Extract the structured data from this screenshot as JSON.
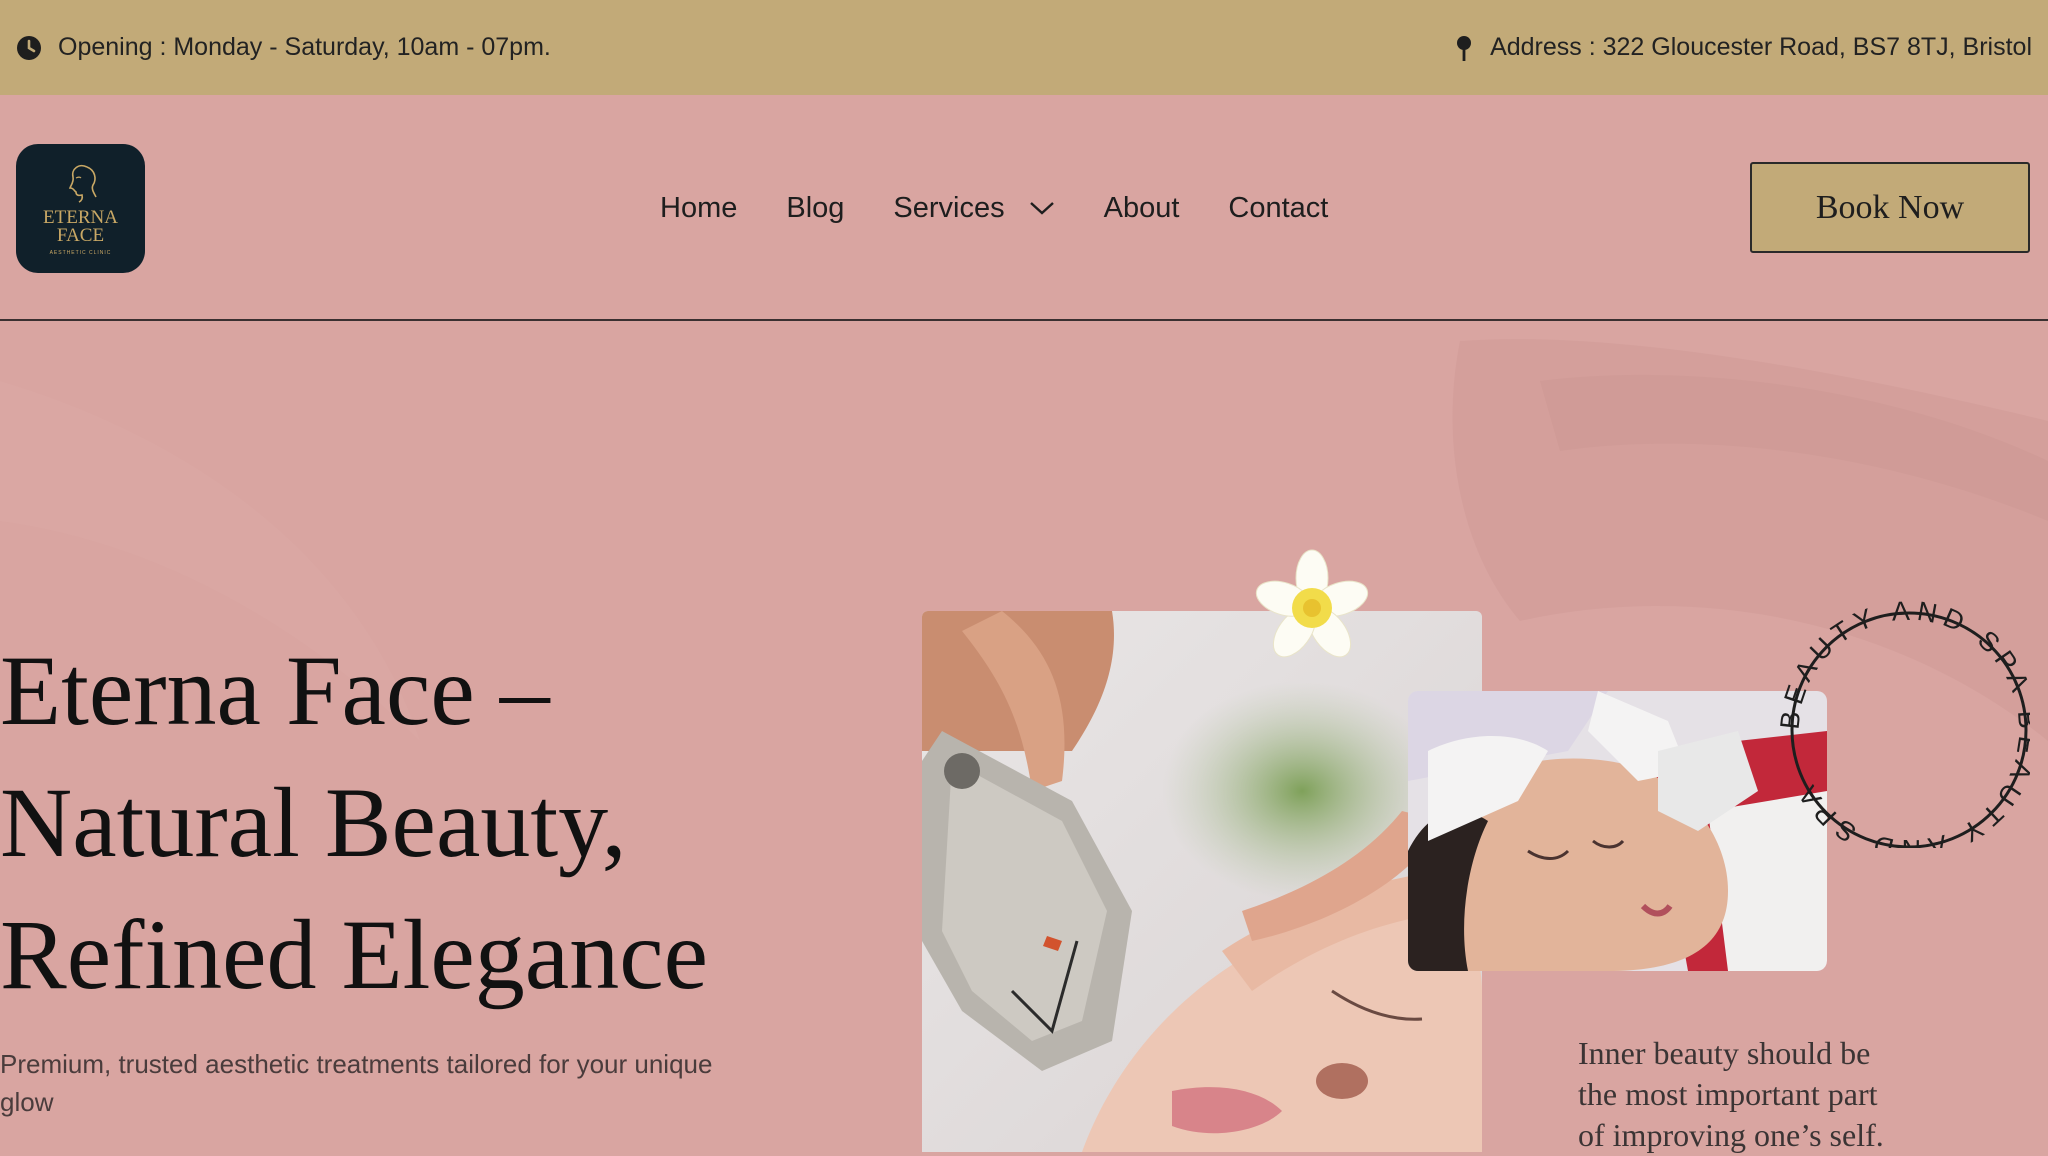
{
  "topbar": {
    "opening": "Opening : Monday - Saturday, 10am - 07pm.",
    "address": "Address : 322 Gloucester Road, BS7 8TJ, Bristol",
    "clock_icon": "clock-icon",
    "pin_icon": "map-pin-icon"
  },
  "logo": {
    "name_line1": "ETERNA",
    "name_line2": "FACE",
    "tagline": "AESTHETIC CLINIC"
  },
  "nav": {
    "home": "Home",
    "blog": "Blog",
    "services": "Services",
    "about": "About",
    "contact": "Contact"
  },
  "book_button": "Book Now",
  "hero": {
    "headline": "Eterna Face –\nNatural Beauty,\nRefined Elegance",
    "subtext": "Premium, trusted aesthetic treatments tailored for your unique glow",
    "badge_text": "BEAUTY AND SPA BEAUTY AND SPA",
    "quote": "Inner beauty should be\nthe most important part\nof improving one’s self."
  },
  "colors": {
    "background": "#d9a5a1",
    "topbar": "#c2aa78",
    "accent": "#c2aa78",
    "logo_bg": "#10202a",
    "logo_gold": "#c9a865"
  }
}
